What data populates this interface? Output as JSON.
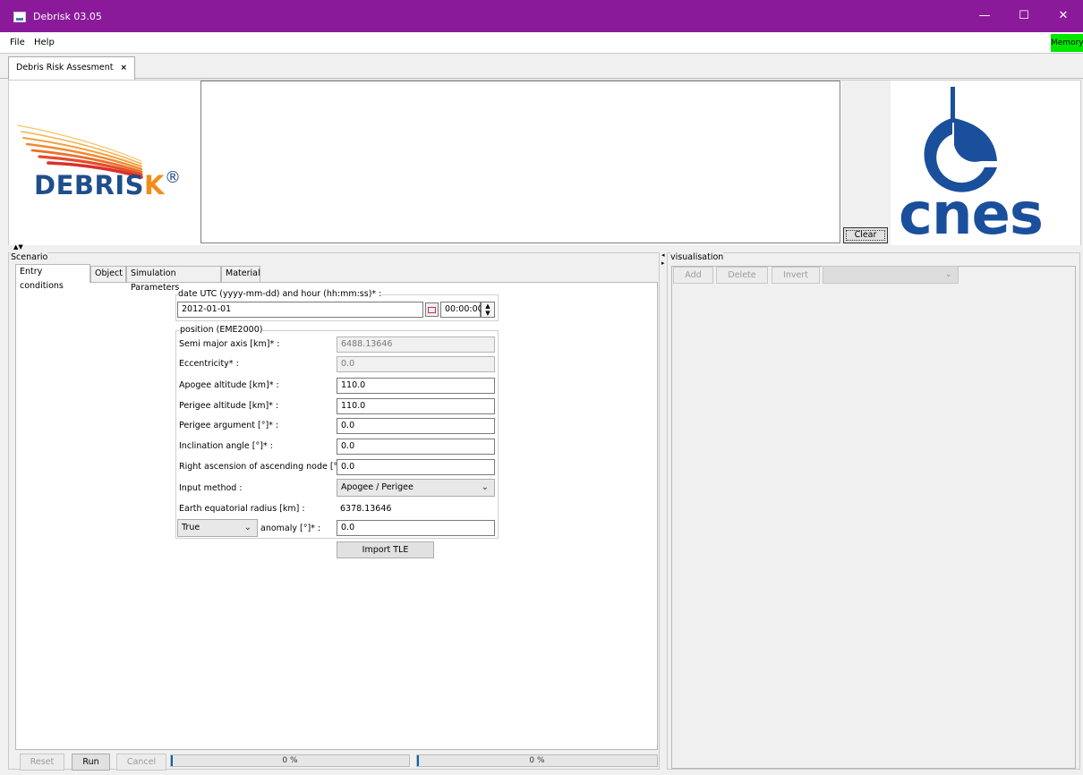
{
  "window": {
    "title": "Debrisk 03.05",
    "minimize": "—",
    "maximize": "☐",
    "close": "✕"
  },
  "menu": {
    "file": "File",
    "help": "Help",
    "memory": "Memory"
  },
  "doc_tab": {
    "label": "Debris Risk Assesment",
    "close": "×"
  },
  "logos": {
    "debrisk_text": "DEBRIS",
    "debrisk_k": "K",
    "debrisk_reg": "®",
    "cnes_text": "cnes"
  },
  "console": {
    "clear_label": "Clear"
  },
  "scenario": {
    "title": "Scenario",
    "tabs": [
      "Entry conditions",
      "Object",
      "Simulation Parameters",
      "Material"
    ],
    "date_group_label": "date UTC (yyyy-mm-dd) and hour (hh:mm:ss)* :",
    "date_value": "2012-01-01",
    "time_value": "00:00:00",
    "position_group_label": "position (EME2000)",
    "fields": [
      {
        "label": "Semi major axis [km]* :",
        "value": "6488.13646",
        "disabled": true
      },
      {
        "label": "Eccentricity* :",
        "value": "0.0",
        "disabled": true
      },
      {
        "label": "Apogee altitude [km]* :",
        "value": "110.0",
        "disabled": false
      },
      {
        "label": "Perigee altitude [km]* :",
        "value": "110.0",
        "disabled": false
      },
      {
        "label": "Perigee argument [°]* :",
        "value": "0.0",
        "disabled": false
      },
      {
        "label": "Inclination angle [°]* :",
        "value": "0.0",
        "disabled": false
      },
      {
        "label": "Right ascension of ascending node [°]* :",
        "value": "0.0",
        "disabled": false
      }
    ],
    "input_method_label": "Input method :",
    "input_method_value": "Apogee / Perigee",
    "earth_radius_label": "Earth equatorial radius [km] :",
    "earth_radius_value": "6378.13646",
    "anomaly_type_value": "True",
    "anomaly_label": "anomaly [°]* :",
    "anomaly_value": "0.0",
    "import_tle_label": "Import TLE",
    "reset_label": "Reset",
    "run_label": "Run",
    "cancel_label": "Cancel",
    "progress1": {
      "text": "0 %",
      "fraction": 0.0
    },
    "progress2": {
      "text": "0 %",
      "fraction": 0.0
    }
  },
  "visualisation": {
    "title": "visualisation",
    "add_label": "Add",
    "delete_label": "Delete",
    "invert_label": "Invert",
    "dropdown_value": ""
  },
  "colors": {
    "titlebar": "#8a1a9a",
    "memory": "#00e600",
    "debrisk_blue": "#1f4e8c",
    "debrisk_orange": "#f28c1a",
    "cnes_blue": "#1a4f9c"
  }
}
